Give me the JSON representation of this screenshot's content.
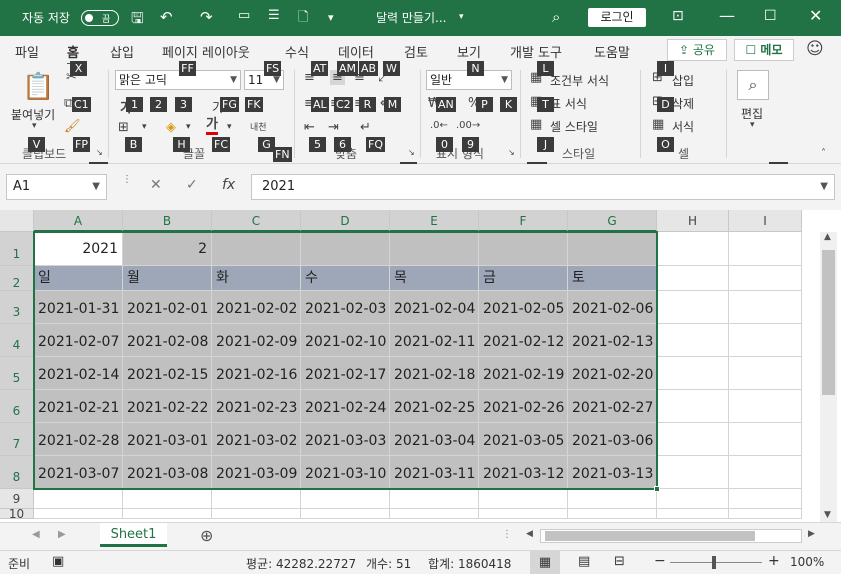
{
  "titlebar": {
    "autosave": "자동 저장",
    "toggle": "끔",
    "filename": "달력 만들기...",
    "login": "로그인",
    "colors": {
      "brand": "#217346"
    }
  },
  "tabs": [
    "파일",
    "홈",
    "삽입",
    "페이지 레이아웃",
    "수식",
    "데이터",
    "검토",
    "보기",
    "개발 도구",
    "도움말"
  ],
  "share": "공유",
  "memo": "메모",
  "ribbon": {
    "clipboard": {
      "paste": "붙여넣기",
      "group": "클립보드"
    },
    "font": {
      "name": "맑은 고딕",
      "size": "11",
      "group": "글꼴",
      "bold_icon": "가",
      "font_color_icon": "가",
      "phonetic_icon": "내천"
    },
    "align": {
      "group": "맞춤"
    },
    "number": {
      "format": "일반",
      "group": "표시 형식"
    },
    "styles": {
      "conditional": "조건부 서식",
      "table": "표 서식",
      "cell": "셀 스타일",
      "group": "스타일"
    },
    "cells": {
      "insert": "삽입",
      "delete": "삭제",
      "format": "서식",
      "group": "셀"
    },
    "editing": {
      "label": "편집"
    }
  },
  "keytips": [
    "X",
    "C1",
    "V",
    "FP",
    "FO",
    "FF",
    "FS",
    "1",
    "2",
    "3",
    "FG",
    "FK",
    "B",
    "H",
    "FC",
    "G",
    "FN",
    "AT",
    "AM",
    "AB",
    "W",
    "AL",
    "C2",
    "R",
    "M",
    "5",
    "6",
    "FQ",
    "FA",
    "N",
    "AN",
    "P",
    "K",
    "0",
    "9",
    "FM",
    "L",
    "T",
    "J",
    "I",
    "D",
    "O",
    "ZE"
  ],
  "formula_bar": {
    "name_box": "A1",
    "fx": "fx",
    "value": "2021"
  },
  "grid": {
    "columns": [
      "A",
      "B",
      "C",
      "D",
      "E",
      "F",
      "G",
      "H",
      "I"
    ],
    "rows": [
      "1",
      "2",
      "3",
      "4",
      "5",
      "6",
      "7",
      "8",
      "9",
      "10"
    ],
    "row1": [
      "2021",
      "2",
      "",
      "",
      "",
      "",
      ""
    ],
    "weekdays": [
      "일",
      "월",
      "화",
      "수",
      "목",
      "금",
      "토"
    ],
    "dates": [
      [
        "2021-01-31",
        "2021-02-01",
        "2021-02-02",
        "2021-02-03",
        "2021-02-04",
        "2021-02-05",
        "2021-02-06"
      ],
      [
        "2021-02-07",
        "2021-02-08",
        "2021-02-09",
        "2021-02-10",
        "2021-02-11",
        "2021-02-12",
        "2021-02-13"
      ],
      [
        "2021-02-14",
        "2021-02-15",
        "2021-02-16",
        "2021-02-17",
        "2021-02-18",
        "2021-02-19",
        "2021-02-20"
      ],
      [
        "2021-02-21",
        "2021-02-22",
        "2021-02-23",
        "2021-02-24",
        "2021-02-25",
        "2021-02-26",
        "2021-02-27"
      ],
      [
        "2021-02-28",
        "2021-03-01",
        "2021-03-02",
        "2021-03-03",
        "2021-03-04",
        "2021-03-05",
        "2021-03-06"
      ],
      [
        "2021-03-07",
        "2021-03-08",
        "2021-03-09",
        "2021-03-10",
        "2021-03-11",
        "2021-03-12",
        "2021-03-13"
      ]
    ],
    "colors": {
      "header_fill": "#9ea7b8",
      "body_fill": "#c0c0c0",
      "selection": "#217346"
    }
  },
  "sheet": {
    "tab": "Sheet1"
  },
  "status": {
    "ready": "준비",
    "average": "평균: 42282.22727",
    "count": "개수: 51",
    "sum": "합계: 1860418",
    "zoom": "100%"
  }
}
